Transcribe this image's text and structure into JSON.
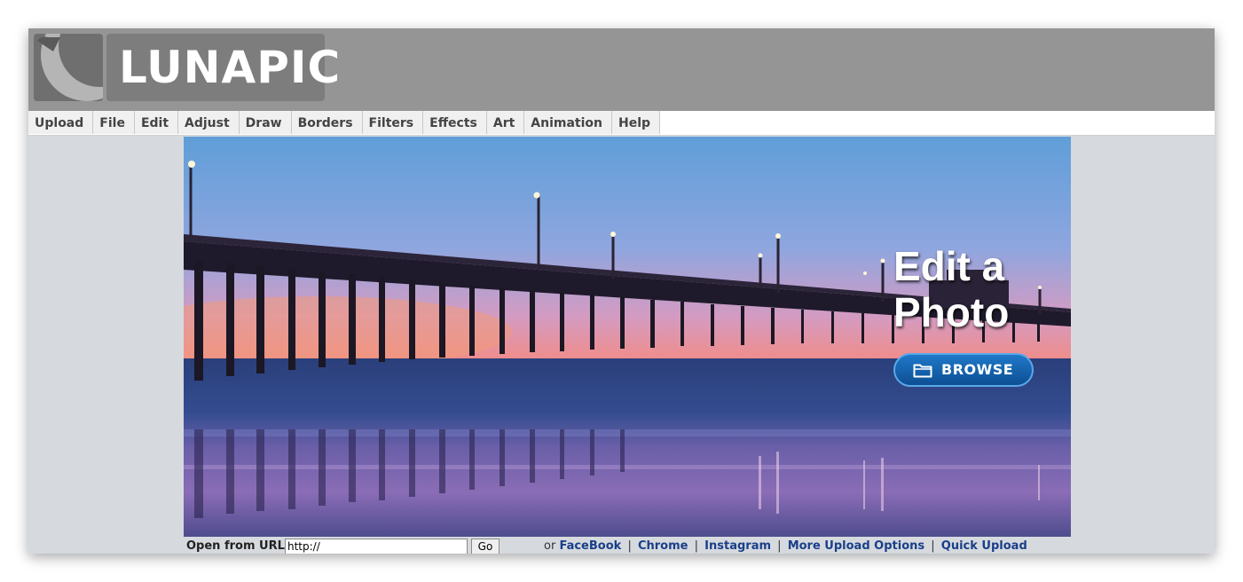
{
  "app": {
    "logo_text": "LUNAPIC"
  },
  "menu": {
    "items": [
      {
        "label": "Upload"
      },
      {
        "label": "File"
      },
      {
        "label": "Edit"
      },
      {
        "label": "Adjust"
      },
      {
        "label": "Draw"
      },
      {
        "label": "Borders"
      },
      {
        "label": "Filters"
      },
      {
        "label": "Effects"
      },
      {
        "label": "Art"
      },
      {
        "label": "Animation"
      },
      {
        "label": "Help"
      }
    ]
  },
  "hero": {
    "title_line1": "Edit a",
    "title_line2": "Photo",
    "browse_label": "BROWSE",
    "browse_icon": "folder-icon",
    "image": "pier-at-sunset"
  },
  "url_open": {
    "label": "Open from URL:",
    "input_value": "http://",
    "go_label": "Go",
    "or_text": "or",
    "links": [
      {
        "label": "FaceBook"
      },
      {
        "label": "Chrome"
      },
      {
        "label": "Instagram"
      },
      {
        "label": "More Upload Options"
      },
      {
        "label": "Quick Upload"
      }
    ],
    "separator": "|"
  },
  "colors": {
    "header_bg": "#959595",
    "page_bg": "#d6dadf",
    "link": "#1a3f88",
    "browse_button": "#1565b0"
  }
}
